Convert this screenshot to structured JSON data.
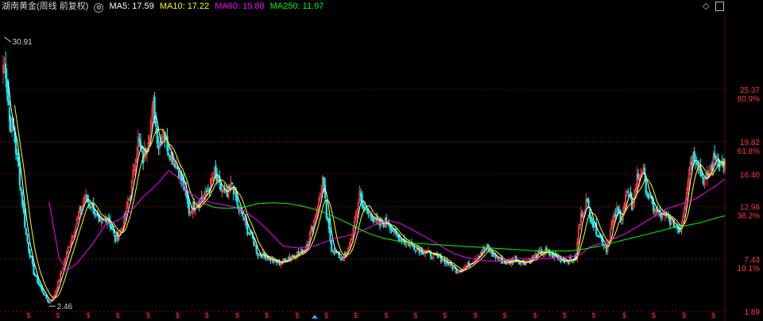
{
  "header": {
    "title": "湖南黄金(周线 前复权)",
    "indicators": [
      {
        "label": "MA5: 17.59",
        "color": "#ffffff"
      },
      {
        "label": "MA10: 17.22",
        "color": "#ffff00"
      },
      {
        "label": "MA60: 15.88",
        "color": "#ff00ff"
      },
      {
        "label": "MA250: 11.97",
        "color": "#00ff00"
      }
    ]
  },
  "colors": {
    "background": "#000000",
    "up": "#ff3c3c",
    "down": "#00ffff",
    "ma5": "#ffffff",
    "ma10": "#ffff00",
    "ma60": "#ff00ff",
    "ma250": "#00ff00",
    "axis": "#ff3c3c",
    "grid": "#7a1010"
  },
  "chart_data": {
    "type": "candlestick",
    "title": "湖南黄金(周线 前复权)",
    "y_ticks": [
      {
        "value": 25.37,
        "label": "25.37",
        "pct": "80.9%"
      },
      {
        "value": 19.82,
        "label": "19.82",
        "pct": "61.8%"
      },
      {
        "value": 16.4,
        "label": "16.40"
      },
      {
        "value": 12.98,
        "label": "12.98",
        "pct": "38.2%"
      },
      {
        "value": 7.43,
        "label": "7.43",
        "pct": "19.1%"
      },
      {
        "value": 1.89,
        "label": "1.89"
      }
    ],
    "ylim": [
      1.89,
      33.5
    ],
    "annotations": [
      {
        "label": "30.91",
        "value": 30.91,
        "index": 1
      },
      {
        "label": "2.46",
        "value": 2.46,
        "index": 36
      }
    ],
    "close_anchors": [
      [
        0,
        28.0
      ],
      [
        2,
        27.5
      ],
      [
        5,
        22.0
      ],
      [
        8,
        21.0
      ],
      [
        12,
        17.0
      ],
      [
        18,
        10.0
      ],
      [
        24,
        6.0
      ],
      [
        30,
        4.2
      ],
      [
        36,
        2.8
      ],
      [
        40,
        3.6
      ],
      [
        46,
        6.2
      ],
      [
        52,
        9.0
      ],
      [
        58,
        11.5
      ],
      [
        64,
        14.0
      ],
      [
        70,
        13.0
      ],
      [
        76,
        11.0
      ],
      [
        82,
        12.0
      ],
      [
        88,
        9.5
      ],
      [
        94,
        11.0
      ],
      [
        100,
        14.5
      ],
      [
        106,
        20.0
      ],
      [
        110,
        18.0
      ],
      [
        114,
        20.5
      ],
      [
        118,
        23.5
      ],
      [
        122,
        19.5
      ],
      [
        126,
        21.0
      ],
      [
        130,
        19.0
      ],
      [
        136,
        17.5
      ],
      [
        142,
        15.0
      ],
      [
        146,
        12.5
      ],
      [
        152,
        13.5
      ],
      [
        158,
        14.0
      ],
      [
        162,
        15.0
      ],
      [
        166,
        16.5
      ],
      [
        170,
        15.0
      ],
      [
        176,
        14.0
      ],
      [
        180,
        15.5
      ],
      [
        184,
        13.0
      ],
      [
        188,
        12.0
      ],
      [
        192,
        10.5
      ],
      [
        196,
        9.5
      ],
      [
        200,
        8.0
      ],
      [
        206,
        7.8
      ],
      [
        212,
        7.2
      ],
      [
        218,
        7.0
      ],
      [
        224,
        7.6
      ],
      [
        230,
        8.0
      ],
      [
        236,
        8.3
      ],
      [
        240,
        9.5
      ],
      [
        244,
        11.5
      ],
      [
        248,
        13.5
      ],
      [
        251,
        16.0
      ],
      [
        254,
        12.0
      ],
      [
        258,
        8.6
      ],
      [
        262,
        8.0
      ],
      [
        266,
        7.5
      ],
      [
        270,
        8.0
      ],
      [
        276,
        11.0
      ],
      [
        280,
        14.5
      ],
      [
        284,
        12.5
      ],
      [
        290,
        12.0
      ],
      [
        296,
        11.0
      ],
      [
        302,
        11.5
      ],
      [
        308,
        10.0
      ],
      [
        314,
        9.5
      ],
      [
        320,
        9.0
      ],
      [
        326,
        8.5
      ],
      [
        332,
        8.2
      ],
      [
        338,
        7.8
      ],
      [
        344,
        7.5
      ],
      [
        350,
        7.0
      ],
      [
        356,
        6.2
      ],
      [
        362,
        6.5
      ],
      [
        368,
        7.2
      ],
      [
        374,
        8.0
      ],
      [
        380,
        8.7
      ],
      [
        384,
        8.0
      ],
      [
        390,
        7.4
      ],
      [
        396,
        7.0
      ],
      [
        402,
        7.5
      ],
      [
        408,
        7.1
      ],
      [
        414,
        7.3
      ],
      [
        420,
        8.0
      ],
      [
        426,
        8.2
      ],
      [
        432,
        7.8
      ],
      [
        438,
        7.4
      ],
      [
        444,
        7.3
      ],
      [
        450,
        7.6
      ],
      [
        452,
        10.5
      ],
      [
        454,
        12.0
      ],
      [
        458,
        13.5
      ],
      [
        464,
        11.0
      ],
      [
        470,
        9.5
      ],
      [
        474,
        8.5
      ],
      [
        478,
        11.0
      ],
      [
        482,
        12.5
      ],
      [
        486,
        12.0
      ],
      [
        490,
        14.5
      ],
      [
        494,
        13.0
      ],
      [
        498,
        16.0
      ],
      [
        502,
        17.0
      ],
      [
        506,
        14.5
      ],
      [
        510,
        13.0
      ],
      [
        516,
        12.0
      ],
      [
        522,
        11.8
      ],
      [
        528,
        11.0
      ],
      [
        532,
        10.5
      ],
      [
        536,
        14.0
      ],
      [
        540,
        18.0
      ],
      [
        544,
        18.5
      ],
      [
        548,
        16.5
      ],
      [
        552,
        15.5
      ],
      [
        556,
        17.0
      ],
      [
        560,
        18.5
      ],
      [
        564,
        17.5
      ],
      [
        567,
        17.6
      ]
    ],
    "moving_averages": {
      "ma60": [
        [
          36,
          13.5
        ],
        [
          44,
          7.5
        ],
        [
          50,
          6.2
        ],
        [
          58,
          7.0
        ],
        [
          70,
          9.0
        ],
        [
          80,
          11.0
        ],
        [
          90,
          11.5
        ],
        [
          100,
          12.5
        ],
        [
          110,
          14.0
        ],
        [
          122,
          15.5
        ],
        [
          130,
          16.8
        ],
        [
          138,
          16.0
        ],
        [
          146,
          14.5
        ],
        [
          154,
          13.8
        ],
        [
          164,
          13.4
        ],
        [
          172,
          13.2
        ],
        [
          180,
          13.0
        ],
        [
          190,
          12.5
        ],
        [
          200,
          11.5
        ],
        [
          210,
          10.2
        ],
        [
          220,
          8.8
        ],
        [
          232,
          8.6
        ],
        [
          244,
          8.8
        ],
        [
          252,
          9.2
        ],
        [
          260,
          9.6
        ],
        [
          268,
          9.8
        ],
        [
          278,
          10.2
        ],
        [
          288,
          10.8
        ],
        [
          296,
          11.3
        ],
        [
          304,
          11.5
        ],
        [
          312,
          11.2
        ],
        [
          322,
          10.5
        ],
        [
          334,
          9.6
        ],
        [
          344,
          8.8
        ],
        [
          354,
          8.0
        ],
        [
          364,
          7.6
        ],
        [
          376,
          7.3
        ],
        [
          388,
          7.2
        ],
        [
          400,
          7.5
        ],
        [
          412,
          7.5
        ],
        [
          426,
          7.5
        ],
        [
          440,
          7.6
        ],
        [
          452,
          7.8
        ],
        [
          462,
          8.8
        ],
        [
          472,
          9.2
        ],
        [
          480,
          9.6
        ],
        [
          490,
          10.2
        ],
        [
          500,
          11.0
        ],
        [
          512,
          12.0
        ],
        [
          522,
          12.8
        ],
        [
          534,
          13.3
        ],
        [
          544,
          13.8
        ],
        [
          552,
          14.5
        ],
        [
          560,
          15.2
        ],
        [
          567,
          15.9
        ]
      ],
      "ma250": [
        [
          158,
          13.3
        ],
        [
          166,
          12.9
        ],
        [
          176,
          12.8
        ],
        [
          188,
          12.9
        ],
        [
          200,
          13.3
        ],
        [
          212,
          13.4
        ],
        [
          224,
          13.3
        ],
        [
          236,
          13.0
        ],
        [
          248,
          12.6
        ],
        [
          260,
          11.9
        ],
        [
          270,
          11.3
        ],
        [
          280,
          10.6
        ],
        [
          290,
          10.0
        ],
        [
          300,
          9.6
        ],
        [
          312,
          9.3
        ],
        [
          324,
          9.1
        ],
        [
          336,
          9.0
        ],
        [
          348,
          8.9
        ],
        [
          360,
          8.8
        ],
        [
          372,
          8.7
        ],
        [
          384,
          8.6
        ],
        [
          396,
          8.5
        ],
        [
          408,
          8.4
        ],
        [
          420,
          8.3
        ],
        [
          432,
          8.3
        ],
        [
          444,
          8.3
        ],
        [
          456,
          8.5
        ],
        [
          468,
          8.8
        ],
        [
          480,
          9.2
        ],
        [
          492,
          9.6
        ],
        [
          504,
          10.0
        ],
        [
          516,
          10.4
        ],
        [
          528,
          10.8
        ],
        [
          538,
          11.0
        ],
        [
          548,
          11.3
        ],
        [
          558,
          11.7
        ],
        [
          567,
          12.0
        ]
      ]
    },
    "dividend_marker_label": "$",
    "dividend_marker_count": 24,
    "grid": true
  }
}
